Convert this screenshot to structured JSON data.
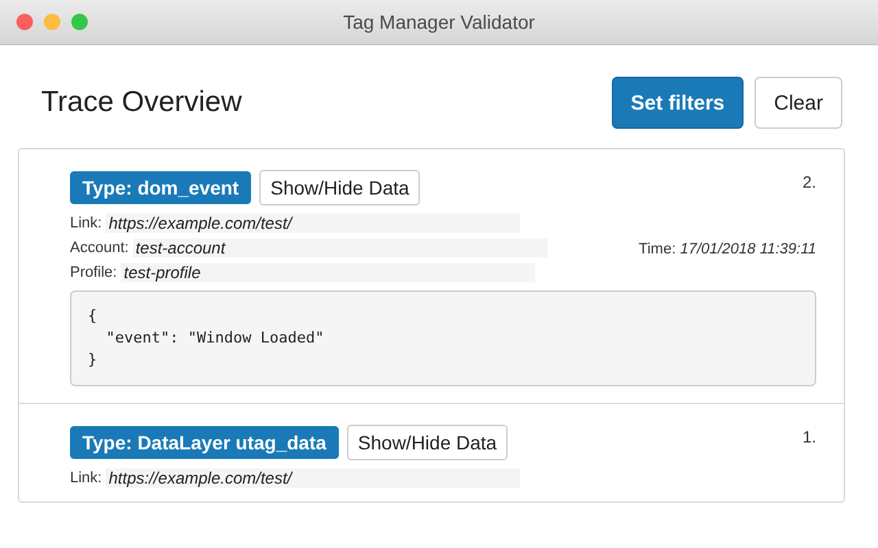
{
  "window": {
    "title": "Tag Manager Validator"
  },
  "heading": "Trace Overview",
  "buttons": [
    {
      "label": "Set filters",
      "kind": "primary"
    },
    {
      "label": "Clear",
      "kind": "default"
    }
  ],
  "events": [
    {
      "type": "Type: dom_event",
      "toggle": "Show/Hide Data",
      "number": "2.",
      "fields": [
        {
          "label": "Link:",
          "value": "https://example.com/test/"
        },
        {
          "label": "Account:",
          "value": "test-account"
        },
        {
          "label": "Profile:",
          "value": "test-profile"
        }
      ],
      "time_label": "Time:",
      "time": "17/01/2018 11:39:11",
      "data": [
        "{",
        "  \"event\": \"Window Loaded\"",
        "}"
      ]
    },
    {
      "type": "Type: DataLayer utag_data",
      "toggle": "Show/Hide Data",
      "number": "1.",
      "fields": [
        {
          "label": "Link:",
          "value": "https://example.com/test/"
        }
      ]
    }
  ]
}
